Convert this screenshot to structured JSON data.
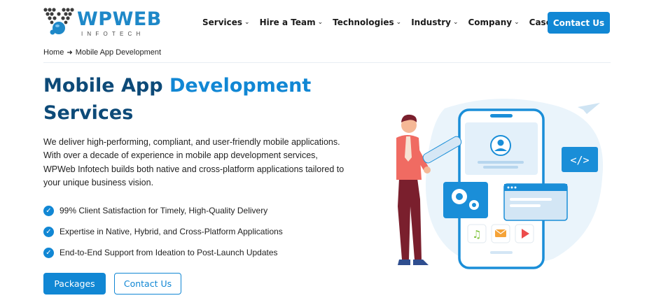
{
  "brand": {
    "name_wp": "WP",
    "name_web": "WEB",
    "subtitle": "INFOTECH"
  },
  "nav": {
    "items": [
      {
        "label": "Services",
        "has_dropdown": true
      },
      {
        "label": "Hire a Team",
        "has_dropdown": true
      },
      {
        "label": "Technologies",
        "has_dropdown": true
      },
      {
        "label": "Industry",
        "has_dropdown": true
      },
      {
        "label": "Company",
        "has_dropdown": true
      },
      {
        "label": "Case Studies",
        "has_dropdown": false
      }
    ],
    "contact_label": "Contact Us"
  },
  "breadcrumb": {
    "home": "Home",
    "current": "Mobile App Development"
  },
  "hero": {
    "title_part1": "Mobile App",
    "title_part2": "Development",
    "title_part3": "Services",
    "description": "We deliver high-performing, compliant, and user-friendly mobile applications. With over a decade of experience in mobile app development services, WPWeb Infotech builds both native and cross-platform applications tailored to your unique business vision.",
    "features": [
      "99% Client Satisfaction for Timely, High-Quality Delivery",
      "Expertise in Native, Hybrid, and Cross-Platform Applications",
      "End-to-End Support from Ideation to Post-Launch Updates"
    ],
    "packages_label": "Packages",
    "contact_label": "Contact Us"
  },
  "illustration": {
    "code_tag": "</>"
  },
  "colors": {
    "primary": "#1187d4",
    "heading": "#0d4a78",
    "light_blue": "#e8f3fb"
  }
}
